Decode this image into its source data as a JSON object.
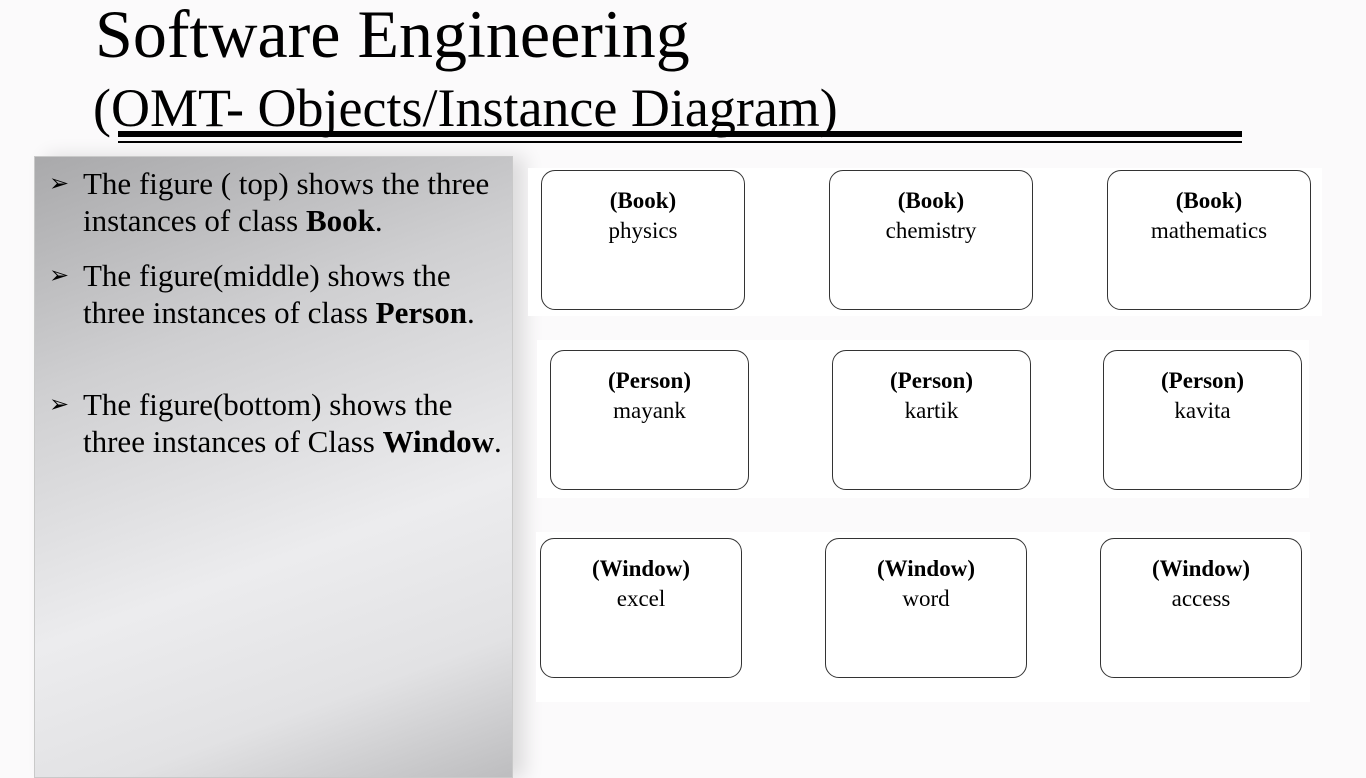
{
  "title": {
    "line1": "Software Engineering",
    "line2": "(OMT- Objects/Instance Diagram)"
  },
  "bullets": [
    {
      "mark": "➢",
      "text_before": "The figure ( top) shows the three instances of class ",
      "bold": "Book",
      "text_after": "."
    },
    {
      "mark": "➢",
      "text_before": " The  figure(middle) shows the three instances of  class ",
      "bold": "Person",
      "text_after": "."
    },
    {
      "mark": "➢",
      "text_before": " The figure(bottom) shows the three instances of Class ",
      "bold": "Window",
      "text_after": "."
    }
  ],
  "rows": [
    {
      "objects": [
        {
          "class": "(Book)",
          "name": "physics"
        },
        {
          "class": "(Book)",
          "name": "chemistry"
        },
        {
          "class": "(Book)",
          "name": "mathematics"
        }
      ]
    },
    {
      "objects": [
        {
          "class": "(Person)",
          "name": "mayank"
        },
        {
          "class": "(Person)",
          "name": "kartik"
        },
        {
          "class": "(Person)",
          "name": "kavita"
        }
      ]
    },
    {
      "objects": [
        {
          "class": "(Window)",
          "name": "excel"
        },
        {
          "class": "(Window)",
          "name": "word"
        },
        {
          "class": "(Window)",
          "name": "access"
        }
      ]
    }
  ]
}
